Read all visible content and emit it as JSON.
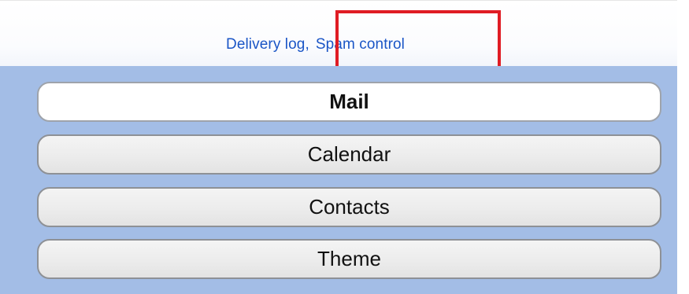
{
  "links": {
    "delivery_log": "Delivery log",
    "separator": ",",
    "spam_control": "Spam control"
  },
  "nav": {
    "items": [
      {
        "label": "Mail",
        "active": true
      },
      {
        "label": "Calendar",
        "active": false
      },
      {
        "label": "Contacts",
        "active": false
      },
      {
        "label": "Theme",
        "active": false
      }
    ]
  },
  "colors": {
    "panel_background": "#a3bde6",
    "link": "#1b56c6",
    "highlight": "#e01c24"
  }
}
